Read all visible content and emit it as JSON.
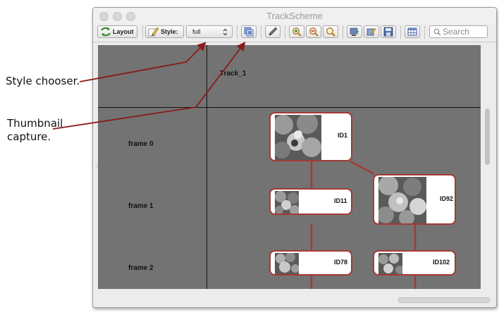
{
  "annotations": {
    "style_chooser": "Style chooser.",
    "thumbnail_line1": "Thumbnail",
    "thumbnail_line2": "capture."
  },
  "window": {
    "title": "TrackScheme"
  },
  "toolbar": {
    "layout_label": "Layout",
    "style_label": "Style:",
    "style_value": "full",
    "search_placeholder": "Search",
    "icons": [
      "layout-icon",
      "style-icon",
      "thumbnail-capture-icon",
      "pencil-icon",
      "zoom-in-icon",
      "zoom-out-icon",
      "zoom-fit-icon",
      "export-icon",
      "select-style-icon",
      "save-icon",
      "table-icon",
      "search-icon"
    ]
  },
  "scheme": {
    "track_name": "Track_1",
    "frames": [
      "frame 0",
      "frame 1",
      "frame 2"
    ],
    "spots": [
      "ID1",
      "ID11",
      "ID92",
      "ID78",
      "ID102"
    ]
  },
  "colors": {
    "canvas": "#737373",
    "node_border": "#a33a33",
    "annotation_arrow": "#8b1a1a"
  }
}
